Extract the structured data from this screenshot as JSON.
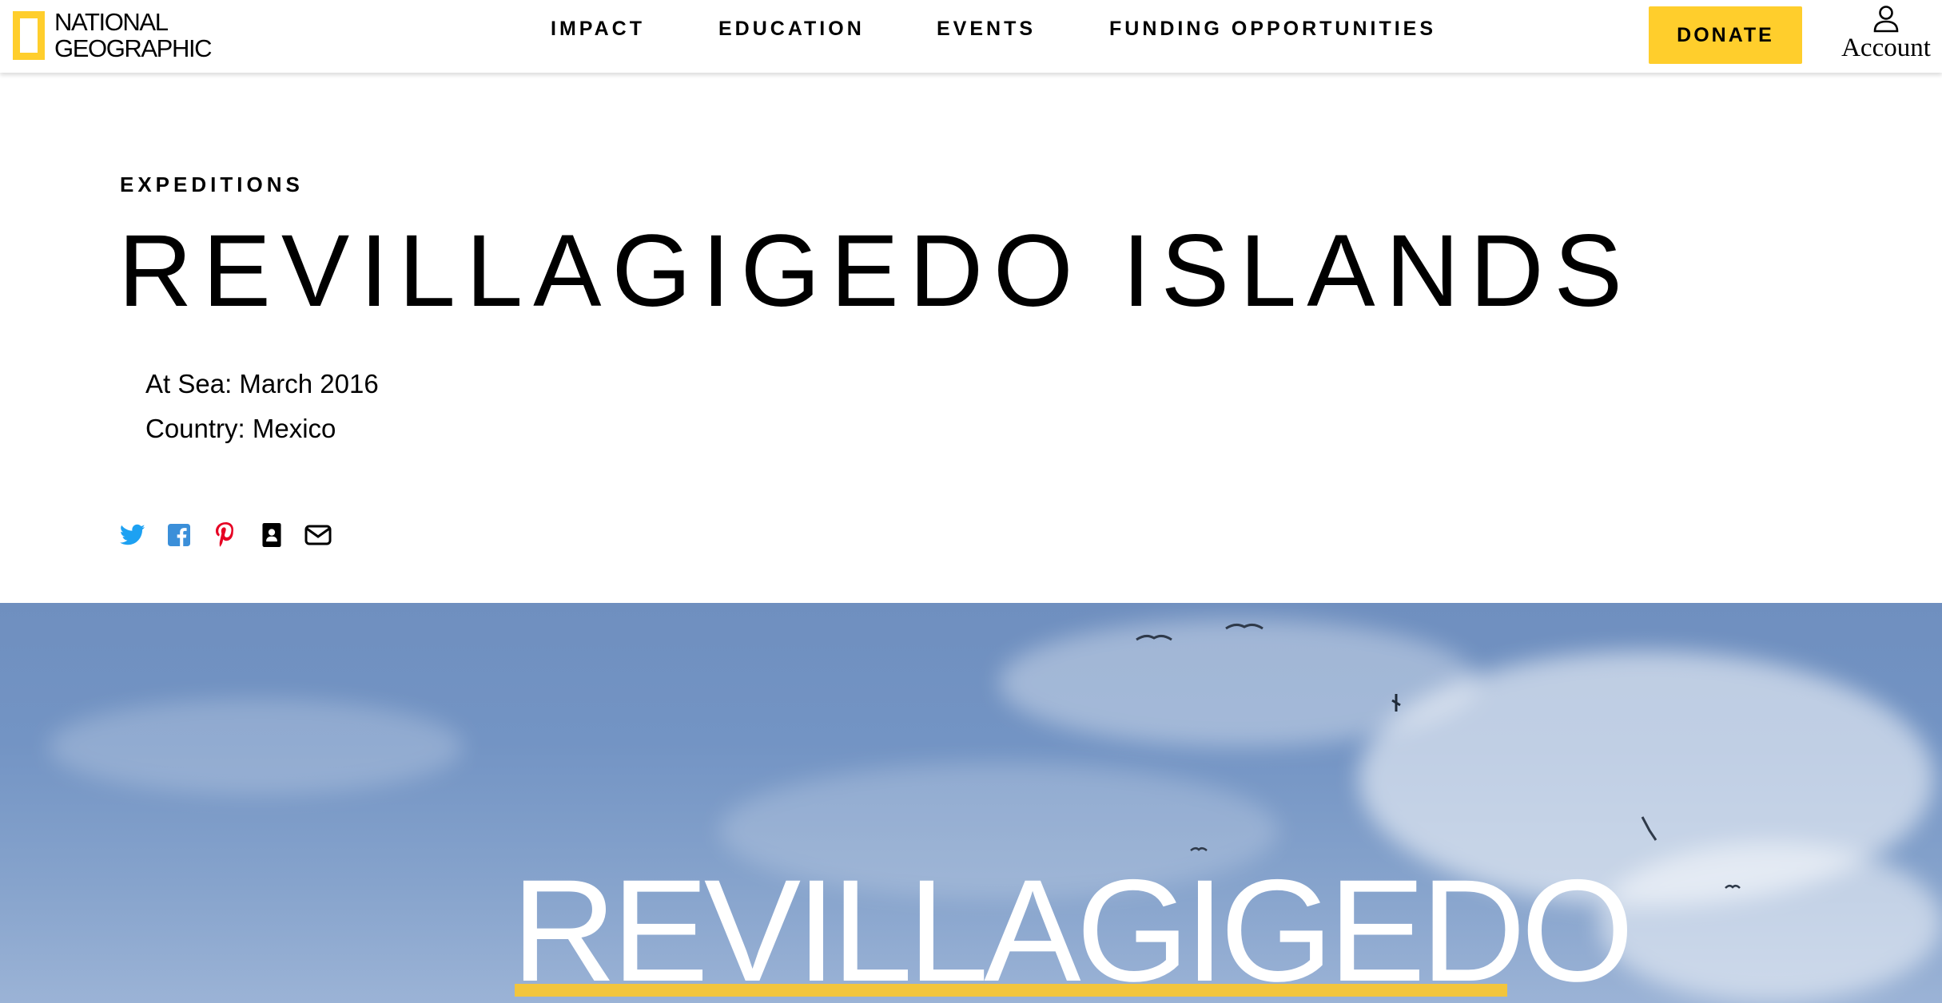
{
  "brand": {
    "name_line1": "NATIONAL",
    "name_line2": "GEOGRAPHIC",
    "accent_color": "#ffce2c"
  },
  "nav": {
    "items": [
      {
        "label": "IMPACT"
      },
      {
        "label": "EDUCATION"
      },
      {
        "label": "EVENTS"
      },
      {
        "label": "FUNDING OPPORTUNITIES"
      }
    ],
    "donate_label": "DONATE",
    "account_label": "Account",
    "account_icon": "user-icon"
  },
  "article": {
    "kicker": "EXPEDITIONS",
    "title": "REVILLAGIGEDO ISLANDS",
    "meta": [
      {
        "text": "At Sea: March 2016"
      },
      {
        "text": "Country: Mexico"
      }
    ]
  },
  "social": [
    {
      "icon": "twitter-icon",
      "color": "#1da1f2"
    },
    {
      "icon": "facebook-icon",
      "color": "#3b8fd9"
    },
    {
      "icon": "pinterest-icon",
      "color": "#e60023"
    },
    {
      "icon": "contact-card-icon",
      "color": "#000000"
    },
    {
      "icon": "email-icon",
      "color": "#000000"
    }
  ],
  "hero": {
    "overlay_text": "REVILLAGIGEDO",
    "underline_color": "#f2c53d"
  }
}
